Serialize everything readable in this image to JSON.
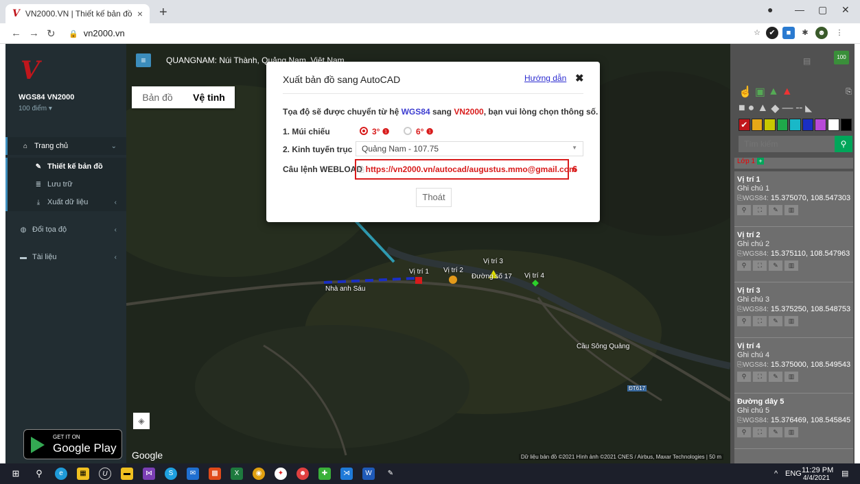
{
  "browser": {
    "tab_title": "VN2000.VN | Thiết kế bản đồ",
    "tab_close": "×",
    "new_tab": "+",
    "url": "vn2000.vn"
  },
  "sidebar": {
    "title": "WGS84 VN2000",
    "subtitle": "100 điểm ▾",
    "items": [
      {
        "label": "Trang chủ"
      },
      {
        "label": "Thiết kế bản đồ"
      },
      {
        "label": "Lưu trữ"
      },
      {
        "label": "Xuất dữ liệu"
      },
      {
        "label": "Đổi tọa độ"
      },
      {
        "label": "Tài liệu"
      }
    ],
    "gplay_small": "GET IT ON",
    "gplay_big": "Google Play"
  },
  "map": {
    "place": "QUANGNAM: Núi Thành, Quảng Nam, Việt Nam",
    "maptype": [
      "Bản đồ",
      "Vệ tinh"
    ],
    "labels": [
      "Vị trí 1",
      "Vị trí 2",
      "Vị trí 3",
      "Vị trí 4",
      "Đường số 17",
      "Nhà anh Sáu",
      "Cầu Sông Quảng",
      "ĐT617"
    ],
    "google": "Google",
    "copyright": "Dữ liệu bản đồ ©2021 Hình ảnh ©2021 CNES / Airbus, Maxar Technologies | 50 m"
  },
  "modal": {
    "title": "Xuất bản đồ sang AutoCAD",
    "help": "Hướng dẫn",
    "close": "✖",
    "intro_a": "Tọa độ sẽ được chuyển từ hệ ",
    "intro_wgs": "WGS84",
    "intro_b": " sang ",
    "intro_vn": "VN2000",
    "intro_c": ", bạn vui lòng chọn thông số.",
    "label_muichieu": "1. Múi chiếu",
    "opt_3": "3° ❶",
    "opt_6": "6° ❶",
    "label_kinhtuyen": "2. Kinh tuyến trục",
    "kinhtuyen_value": "Quảng Nam - 107.75",
    "label_cmd": "Câu lệnh WEBLOAD",
    "cmd_url": "https://vn2000.vn/autocad/augustus.mmo@gmail.com",
    "annotation": "6",
    "exit": "Thoát"
  },
  "rpanel": {
    "badge": "100",
    "search_placeholder": "Tìm kiếm",
    "layer": "Lớp 1",
    "items": [
      {
        "name": "Vị trí 1",
        "note": "Ghi chú 1",
        "sys": "WGS84:",
        "coord": "15.375070, 108.547303"
      },
      {
        "name": "Vị trí 2",
        "note": "Ghi chú 2",
        "sys": "WGS84:",
        "coord": "15.375110, 108.547963"
      },
      {
        "name": "Vị trí 3",
        "note": "Ghi chú 3",
        "sys": "WGS84:",
        "coord": "15.375250, 108.548753"
      },
      {
        "name": "Vị trí 4",
        "note": "Ghi chú 4",
        "sys": "WGS84:",
        "coord": "15.375000, 108.549543"
      },
      {
        "name": "Đường dây 5",
        "note": "Ghi chú 5",
        "sys": "WGS84:",
        "coord": "15.376469, 108.545845"
      }
    ]
  },
  "taskbar": {
    "lang": "ENG",
    "time": "11:29 PM",
    "date": "4/4/2021"
  }
}
